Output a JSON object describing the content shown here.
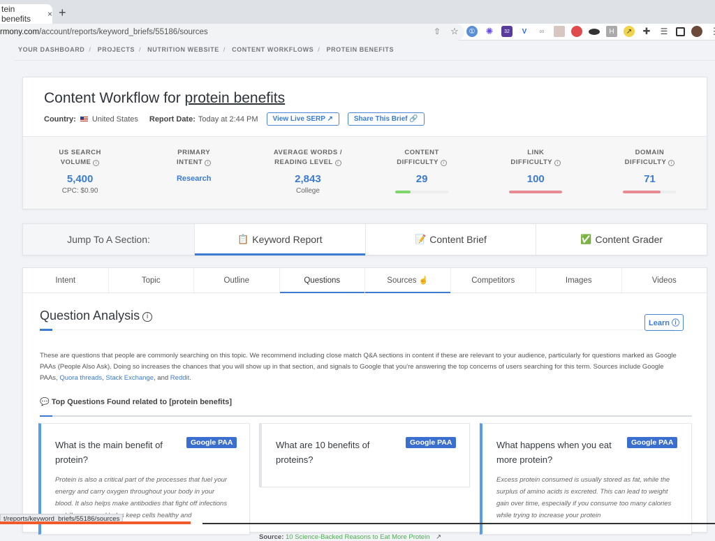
{
  "browser": {
    "tab_title": "tein benefits",
    "tab_close": "×",
    "new_tab": "+",
    "url_domain": "rmony.com",
    "url_path": "/account/reports/keyword_briefs/55186/sources",
    "extension_icons": [
      "share-icon",
      "star-icon",
      "onepassword-icon",
      "gear-extension-icon",
      "badge-extension-icon",
      "v-extension-icon",
      "link-extension-icon",
      "image-extension-icon",
      "red-extension-icon",
      "hat-extension-icon",
      "h-extension-icon",
      "yellow-extension-icon",
      "puzzle-icon",
      "playlist-icon",
      "sidepanel-icon",
      "profile-avatar",
      "menu-icon"
    ],
    "extension_badge": "32",
    "status_url": "t/reports/keyword_briefs/55186/sources"
  },
  "breadcrumbs": [
    "YOUR DASHBOARD",
    "PROJECTS",
    "NUTRITION WEBSITE",
    "CONTENT WORKFLOWS",
    "PROTEIN BENEFITS"
  ],
  "header": {
    "title_prefix": "Content Workflow for ",
    "keyword": "protein benefits",
    "country_label": "Country:",
    "country_value": "United States",
    "report_date_label": "Report Date:",
    "report_date_value": "Today at 2:44 PM",
    "view_serp": "View Live SERP ↗",
    "share_brief": "Share This Brief 🔗"
  },
  "stats": [
    {
      "label1": "US SEARCH",
      "label2": "VOLUME",
      "value": "5,400",
      "sub": "CPC: $0.90"
    },
    {
      "label1": "PRIMARY",
      "label2": "INTENT",
      "value": "Research",
      "sub": ""
    },
    {
      "label1": "AVERAGE WORDS /",
      "label2": "READING LEVEL",
      "value": "2,843",
      "sub": "College"
    },
    {
      "label1": "CONTENT",
      "label2": "DIFFICULTY",
      "value": "29",
      "bar": 0.29,
      "bar_color": "#7ed66a"
    },
    {
      "label1": "LINK",
      "label2": "DIFFICULTY",
      "value": "100",
      "bar": 1.0,
      "bar_color": "#e88a92"
    },
    {
      "label1": "DOMAIN",
      "label2": "DIFFICULTY",
      "value": "71",
      "bar": 0.71,
      "bar_color": "#e88a92"
    }
  ],
  "jump": {
    "label": "Jump To A Section:",
    "items": [
      {
        "icon": "📋",
        "label": "Keyword Report"
      },
      {
        "icon": "📝",
        "label": "Content Brief"
      },
      {
        "icon": "✅",
        "label": "Content Grader"
      }
    ]
  },
  "subtabs": [
    "Intent",
    "Topic",
    "Outline",
    "Questions",
    "Sources",
    "Competitors",
    "Images",
    "Videos"
  ],
  "qa": {
    "title": "Question Analysis",
    "learn": "Learn ⓘ",
    "desc_1": "These are questions that people are commonly searching on this topic. We recommend including close match Q&A sections in content if these are relevant to your audience, particularly for questions marked as Google PAAs (People Also Ask). Doing so increases the chances that you will show up in that section, and signals to Google that you're answering the top concerns of users searching for this term. Sources include Google PAAs, ",
    "link_quora": "Quora threads",
    "comma": ", ",
    "link_stack": "Stack Exchange",
    "and": ", and ",
    "link_reddit": "Reddit",
    "period": ".",
    "top_questions": "💬 Top Questions Found related to [protein benefits]"
  },
  "questions": [
    {
      "question": "What is the main benefit of protein?",
      "badge": "Google PAA",
      "answer": "Protein is also a critical part of the processes that fuel your energy and carry oxygen throughout your body in your blood. It also helps make antibodies that fight off infections and illnesses and helps keep cells healthy and"
    },
    {
      "question": "What are 10 benefits of proteins?",
      "badge": "Google PAA",
      "answer": "",
      "source_label": "Source:",
      "source_link": "10 Science-Backed Reasons to Eat More Protein"
    },
    {
      "question": "What happens when you eat more protein?",
      "badge": "Google PAA",
      "answer": "Excess protein consumed is usually stored as fat, while the surplus of amino acids is excreted. This can lead to weight gain over time, especially if you consume too many calories while trying to increase your protein"
    }
  ]
}
